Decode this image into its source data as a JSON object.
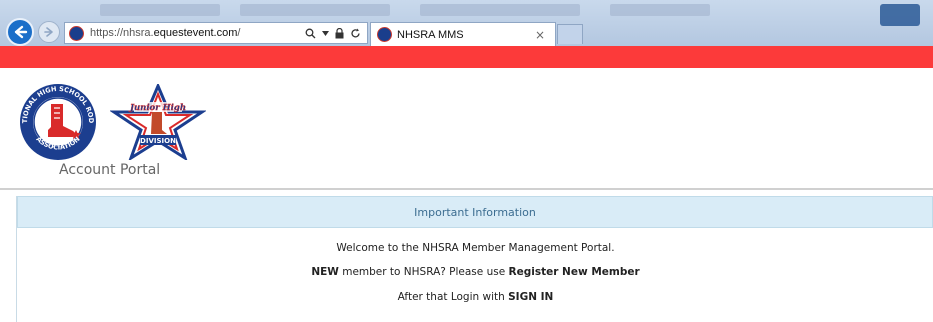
{
  "browser": {
    "url_prefix": "https://nhsra.",
    "url_domain": "equestevent.com",
    "url_suffix": "/",
    "tab_title": "NHSRA MMS",
    "tab_close": "×"
  },
  "header": {
    "portal_title": "Account Portal",
    "logo_nhsra_text": "NATIONAL HIGH SCHOOL RODEO ASSOCIATION",
    "logo_jh_text_top": "Junior High",
    "logo_jh_text_bottom": "DIVISION"
  },
  "panel": {
    "heading": "Important Information",
    "welcome": "Welcome to the NHSRA Member Management Portal.",
    "new_word": "NEW",
    "new_middle": " member to NHSRA? Please use ",
    "register_label": "Register New Member",
    "after_text": "After that Login with ",
    "signin_label": "SIGN IN"
  },
  "colors": {
    "red_band": "#fc3a3a",
    "panel_head_bg": "#d9ecf7",
    "panel_head_text": "#3c6d91",
    "browser_back": "#1b6fc9"
  },
  "icons": {
    "back": "arrow-left-icon",
    "forward": "arrow-right-icon",
    "search": "search-icon",
    "lock": "lock-icon",
    "refresh": "refresh-icon"
  }
}
